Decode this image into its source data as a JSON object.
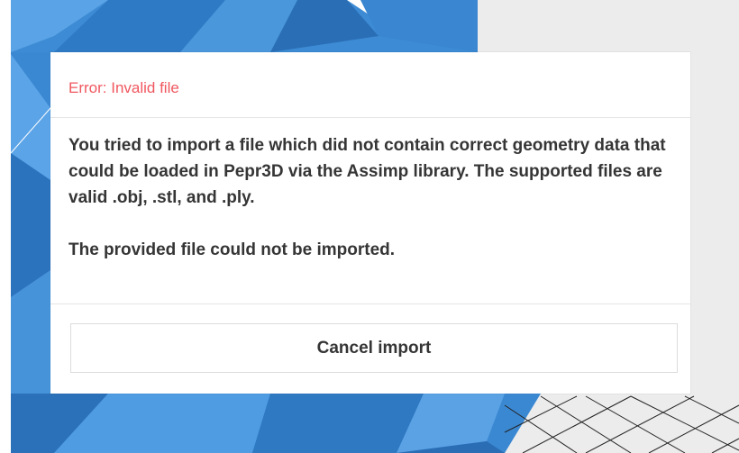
{
  "dialog": {
    "title": "Error: Invalid file",
    "message_paragraph_1": "You tried to import a file which did not contain correct geometry data that could be loaded in Pepr3D via the Assimp library. The supported files are valid .obj, .stl, and .ply.",
    "message_paragraph_2": "The provided file could not be imported.",
    "cancel_label": "Cancel import"
  },
  "colors": {
    "error_title": "#f0575f",
    "text": "#353535",
    "mesh_blue": "#3f8fd8",
    "viewport_bg": "#e9e9e9"
  }
}
